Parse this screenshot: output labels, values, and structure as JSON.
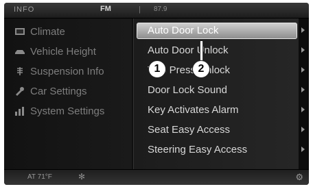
{
  "status_bar": {
    "info": "INFO",
    "radio": "FM",
    "separator": "|",
    "status": "87.9"
  },
  "left_menu": {
    "items": [
      {
        "label": "Climate",
        "icon": "climate-icon"
      },
      {
        "label": "Vehicle Height",
        "icon": "vehicle-height-icon"
      },
      {
        "label": "Suspension Info",
        "icon": "suspension-icon"
      },
      {
        "label": "Car Settings",
        "icon": "car-settings-icon"
      },
      {
        "label": "System Settings",
        "icon": "system-settings-icon"
      }
    ]
  },
  "right_menu": {
    "selected_index": 0,
    "items": [
      {
        "label": "Auto Door Lock"
      },
      {
        "label": "Auto Door Unlock"
      },
      {
        "label": "Two Press Unlock"
      },
      {
        "label": "Door Lock Sound"
      },
      {
        "label": "Key Activates Alarm"
      },
      {
        "label": "Seat Easy Access"
      },
      {
        "label": "Steering Easy Access"
      }
    ]
  },
  "callouts": [
    "1",
    "2"
  ],
  "bottom_bar": {
    "temperature": "AT 71°F",
    "fan_icon": "fan-icon",
    "settings_icon": "gear-icon"
  }
}
